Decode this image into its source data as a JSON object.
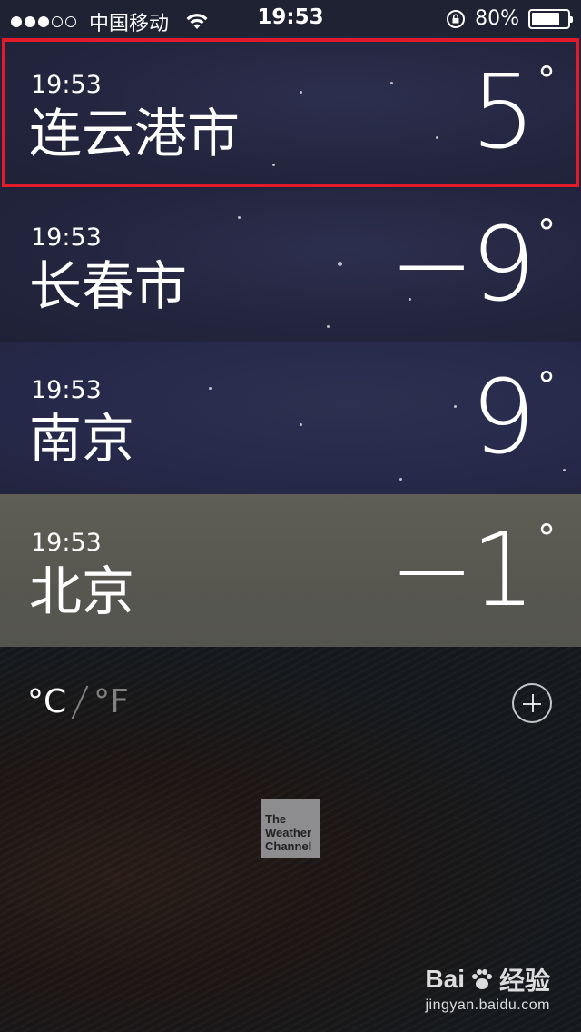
{
  "status_bar": {
    "carrier": "中国移动",
    "time": "19:53",
    "battery_percent": "80%",
    "battery_level": 0.8,
    "signal_bars_filled": 3,
    "signal_bars_total": 5
  },
  "cities": [
    {
      "time": "19:53",
      "name": "连云港市",
      "temp": "5",
      "degree": "°",
      "selected": true
    },
    {
      "time": "19:53",
      "name": "长春市",
      "temp": "−9",
      "degree": "°",
      "selected": false
    },
    {
      "time": "19:53",
      "name": "南京",
      "temp": "9",
      "degree": "°",
      "selected": false
    },
    {
      "time": "19:53",
      "name": "北京",
      "temp": "−1",
      "degree": "°",
      "selected": false
    }
  ],
  "units": {
    "celsius": "°C",
    "fahrenheit": "°F",
    "active": "celsius"
  },
  "logo": {
    "line1": "The",
    "line2": "Weather",
    "line3": "Channel"
  },
  "watermark": {
    "brand": "Bai",
    "brand_cn": "经验",
    "url": "jingyan.baidu.com"
  },
  "colors": {
    "highlight": "#e11b2a",
    "night_row": "#262a45",
    "fog_row": "#5a5a52"
  }
}
